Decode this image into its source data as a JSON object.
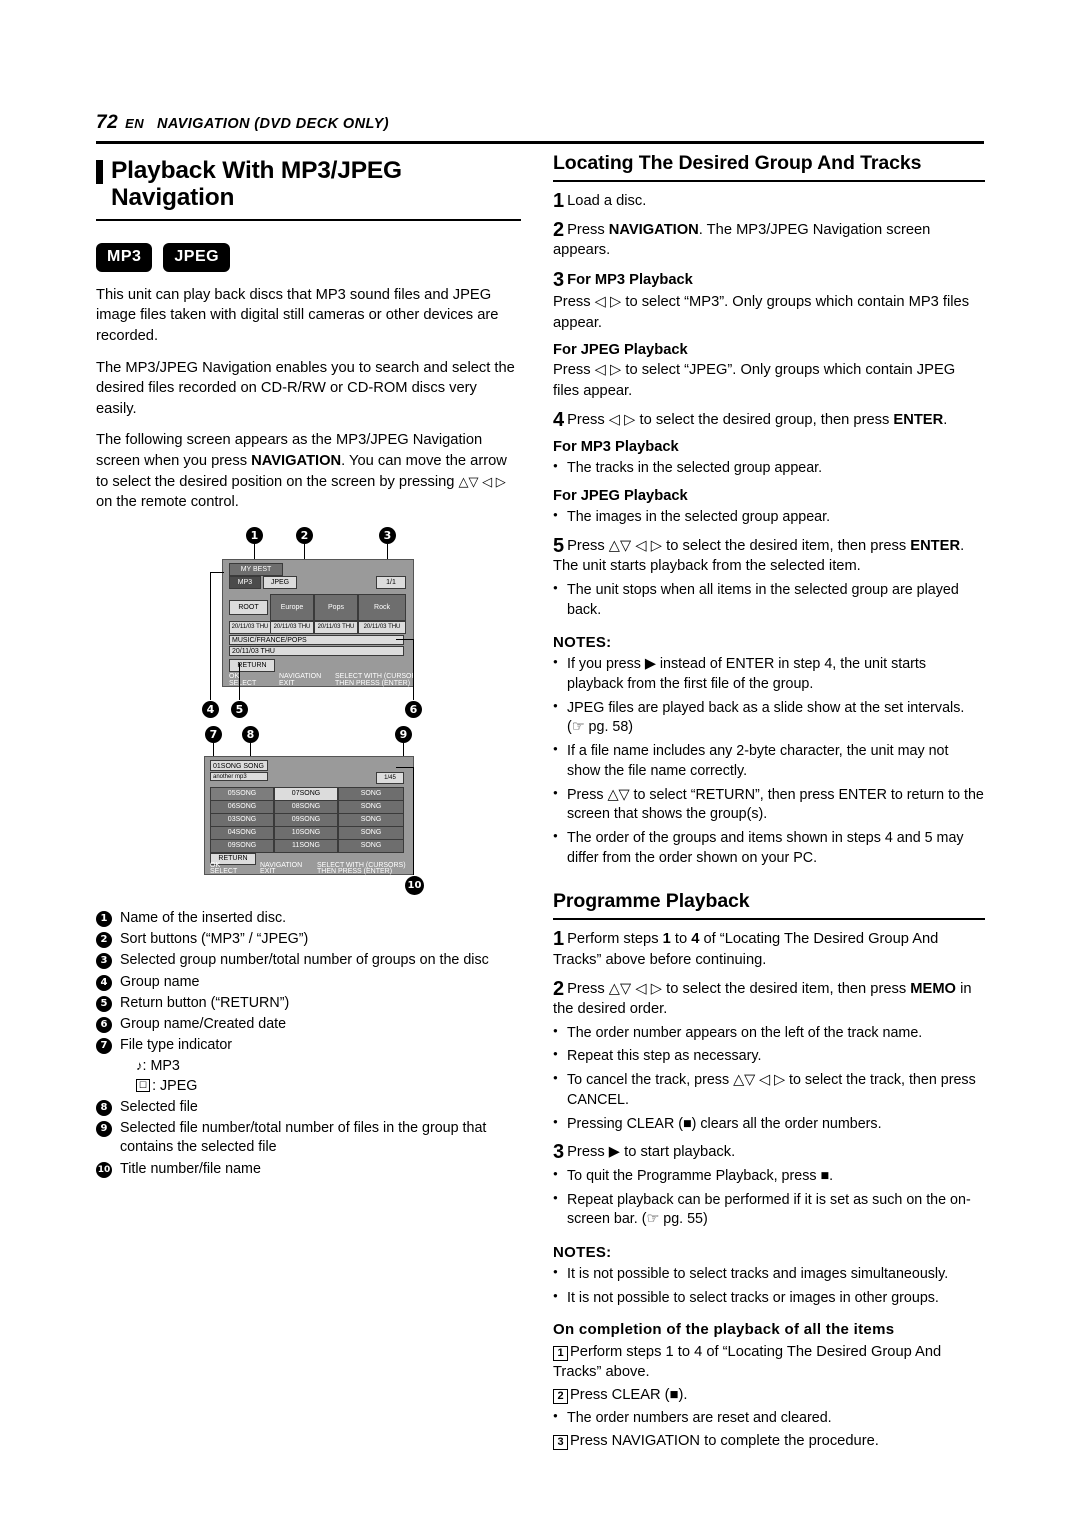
{
  "header": {
    "page_number": "72",
    "en": "EN",
    "chapter": "NAVIGATION (DVD DECK ONLY)"
  },
  "left": {
    "title": "Playback With MP3/JPEG Navigation",
    "badges": [
      "MP3",
      "JPEG"
    ],
    "paragraphs": [
      "This unit can play back discs that MP3 sound files and JPEG image files taken with digital still cameras or other devices are recorded.",
      "The MP3/JPEG Navigation enables you to search and select the desired files recorded on CD-R/RW or CD-ROM discs very easily."
    ],
    "para3_a": "The following screen appears as the MP3/JPEG Navigation screen when you press ",
    "para3_b": "NAVIGATION",
    "para3_c": ". You can move the arrow to select the desired position on the screen by pressing ",
    "para3_d": " on the remote control.",
    "figure": {
      "callouts": [
        "1",
        "2",
        "3",
        "4",
        "5",
        "6",
        "7",
        "8",
        "9",
        "10"
      ],
      "screen1": {
        "disc_name": "MY BEST",
        "sort_mp3": "MP3",
        "sort_jpeg": "JPEG",
        "page_indicator": "1/1",
        "root": "ROOT",
        "groups": [
          "Europe",
          "Pops",
          "Rock"
        ],
        "dates": [
          "20/11/03 THU",
          "20/11/03 THU",
          "20/11/03 THU",
          "20/11/03 THU"
        ],
        "group_path": "MUSIC/FRANCE/POPS",
        "group_date": "20/11/03 THU",
        "return": "RETURN",
        "hint_ok": "OK",
        "hint_nav": "NAVIGATION",
        "hint_select_cursor": "SELECT WITH (CURSORS)",
        "hint_select": "SELECT",
        "hint_exit": "EXIT",
        "hint_press_enter": "THEN PRESS (ENTER)"
      },
      "screen2": {
        "title": "01SONG SONG",
        "subtitle": "another mp3",
        "file_index": "1/45",
        "rows": [
          [
            "05SONG",
            "07SONG",
            "SONG"
          ],
          [
            "06SONG",
            "08SONG",
            "SONG"
          ],
          [
            "03SONG",
            "09SONG",
            "SONG"
          ],
          [
            "04SONG",
            "10SONG",
            "SONG"
          ],
          [
            "09SONG",
            "11SONG",
            "SONG"
          ]
        ],
        "return": "RETURN",
        "hint_ok": "OK",
        "hint_nav": "NAVIGATION",
        "hint_select_cursor": "SELECT WITH (CURSORS)",
        "hint_select": "SELECT",
        "hint_exit": "EXIT",
        "hint_press_enter": "THEN PRESS (ENTER)"
      }
    },
    "legend": [
      "Name of the inserted disc.",
      "Sort buttons (“MP3” / “JPEG”)",
      "Selected group number/total number of groups on the disc",
      "Group name",
      "Return button (“RETURN”)",
      "Group name/Created date",
      "File type indicator",
      "Selected file",
      "Selected file number/total number of files in the group that contains the selected file",
      "Title number/file name"
    ],
    "legend7_sub": [
      ": MP3",
      ": JPEG"
    ]
  },
  "right": {
    "section1": {
      "title": "Locating The Desired Group And Tracks",
      "steps": [
        {
          "n": "1",
          "text": "Load a disc."
        },
        {
          "n": "2",
          "text_a": "Press ",
          "bold": "NAVIGATION",
          "text_b": ". The MP3/JPEG Navigation screen appears."
        },
        {
          "n": "3",
          "head": "For MP3 Playback",
          "text": "Press ◁ ▷ to select “MP3”. Only groups which contain MP3 files appear."
        },
        {
          "n": "",
          "head": "For JPEG Playback",
          "text": "Press ◁ ▷ to select “JPEG”. Only groups which contain JPEG files appear."
        },
        {
          "n": "4",
          "text_a": "Press ◁ ▷ to select the desired group, then press ",
          "bold": "ENTER",
          "text_b": "."
        },
        {
          "n": "5",
          "text_a": "Press △▽ ◁ ▷ to select the desired item, then press ",
          "bold": "ENTER",
          "text_b": ". The unit starts playback from the selected item."
        }
      ],
      "sub_mp3": "For MP3 Playback",
      "sub_mp3_bullet": "The tracks in the selected group appear.",
      "sub_jpeg": "For JPEG Playback",
      "sub_jpeg_bullet": "The images in the selected group appear.",
      "bullet_after5": "The unit stops when all items in the selected group are played back.",
      "notes_title": "NOTES:",
      "notes": [
        "If you press ▶ instead of ENTER in step 4, the unit starts playback from the first file of the group.",
        "JPEG files are played back as a slide show at the set intervals. (☞ pg. 58)",
        "If a file name includes any 2-byte character, the unit may not show the file name correctly.",
        "Press △▽ to select “RETURN”, then press ENTER to return to the screen that shows the group(s).",
        "The order of the groups and items shown in steps 4 and 5 may differ from the order shown on your PC."
      ]
    },
    "section2": {
      "title": "Programme Playback",
      "step1_a": "Perform steps ",
      "step1_b": "1",
      "step1_c": " to ",
      "step1_d": "4",
      "step1_e": " of “Locating The Desired Group And Tracks” above before continuing.",
      "step2_a": "Press △▽ ◁ ▷ to select the desired item, then press ",
      "step2_b": "MEMO",
      "step2_c": " in the desired order.",
      "bullets2": [
        "The order number appears on the left of the track name.",
        "Repeat this step as necessary.",
        "To cancel the track, press △▽ ◁ ▷ to select the track, then press CANCEL.",
        "Pressing CLEAR (■) clears all the order numbers."
      ],
      "step3": "Press ▶ to start playback.",
      "bullets3": [
        "To quit the Programme Playback, press ■.",
        "Repeat playback can be performed if it is set as such on the on-screen bar. (☞ pg. 55)"
      ],
      "notes_title": "NOTES:",
      "notes": [
        "It is not possible to select tracks and images simultaneously.",
        "It is not possible to select tracks or images in other groups."
      ],
      "completion_title": "On completion of the playback of all the items",
      "completion_steps": [
        {
          "n": "1",
          "text": "Perform steps 1 to 4 of “Locating The Desired Group And Tracks” above."
        },
        {
          "n": "2",
          "text": "Press CLEAR (■)."
        },
        {
          "n": "3",
          "text": "Press NAVIGATION to complete the procedure."
        }
      ],
      "completion_bullet": "The order numbers are reset and cleared."
    }
  }
}
